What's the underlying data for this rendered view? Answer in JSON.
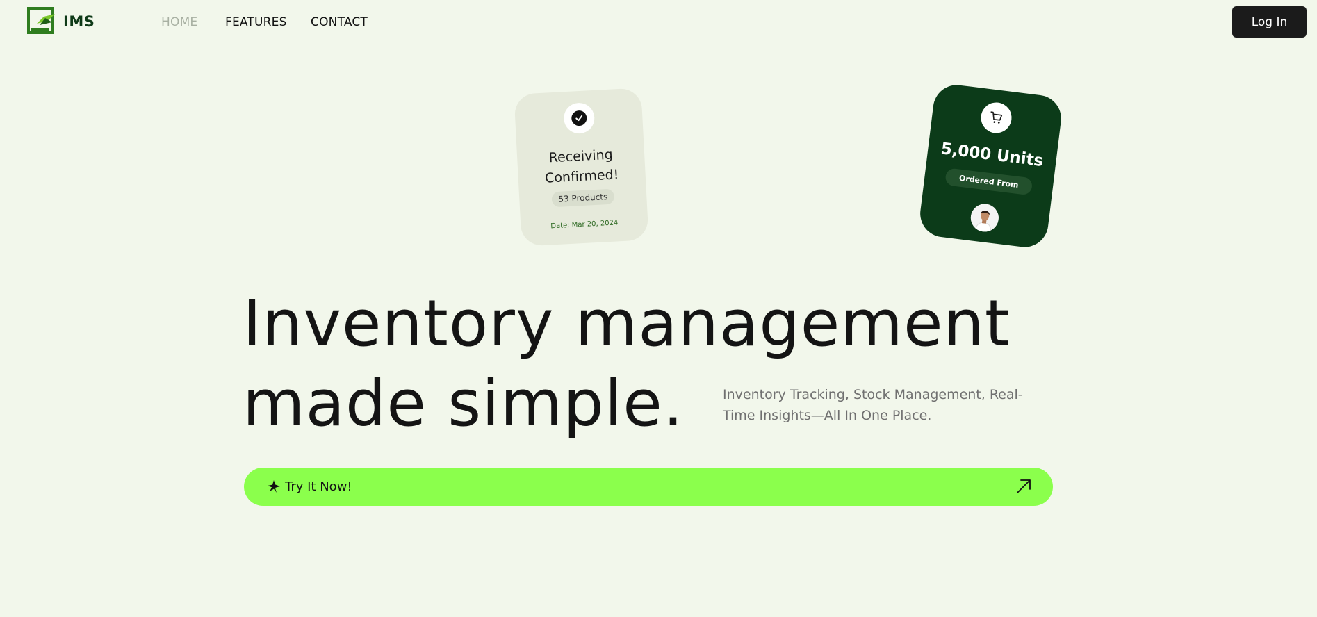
{
  "header": {
    "brand": "IMS",
    "nav": [
      {
        "label": "HOME",
        "active": true
      },
      {
        "label": "FEATURES",
        "active": false
      },
      {
        "label": "CONTACT",
        "active": false
      }
    ],
    "login_label": "Log In"
  },
  "cards": {
    "receiving": {
      "title_line1": "Receiving",
      "title_line2": "Confirmed!",
      "pill": "53 Products",
      "date": "Date: Mar 20, 2024",
      "icon": "check-icon"
    },
    "order": {
      "units": "5,000 Units",
      "pill": "Ordered From",
      "icon": "cart-icon"
    }
  },
  "hero": {
    "line1": "Inventory management",
    "line2": "made simple.",
    "subtitle": "Inventory Tracking, Stock Management, Real-Time Insights—All In One Place.",
    "cta_label": "Try It Now!"
  },
  "colors": {
    "background": "#f2f7eb",
    "brand_green": "#0c3b19",
    "cta_green": "#8bff4c",
    "login_bg": "#1b1b1b"
  }
}
